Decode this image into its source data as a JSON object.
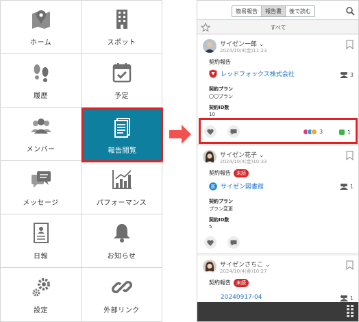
{
  "menu": {
    "items": [
      {
        "label": "ホーム",
        "icon": "map-icon"
      },
      {
        "label": "スポット",
        "icon": "building-icon"
      },
      {
        "label": "履歴",
        "icon": "footprints-icon"
      },
      {
        "label": "予定",
        "icon": "calendar-check-icon"
      },
      {
        "label": "メンバー",
        "icon": "members-icon"
      },
      {
        "label": "報告閲覧",
        "icon": "document-icon"
      },
      {
        "label": "メッセージ",
        "icon": "chat-icon"
      },
      {
        "label": "パフォーマンス",
        "icon": "bar-chart-icon"
      },
      {
        "label": "日報",
        "icon": "daily-report-icon"
      },
      {
        "label": "お知らせ",
        "icon": "bell-icon"
      },
      {
        "label": "設定",
        "icon": "gears-icon"
      },
      {
        "label": "外部リンク",
        "icon": "link-icon"
      }
    ],
    "active_index": 5
  },
  "colors": {
    "accent": "#0e7f9e",
    "highlight": "#e02424",
    "link": "#1e73c8",
    "badge": "#d62828"
  },
  "phone": {
    "tabs": [
      "簡易報告",
      "報告書",
      "後で読む"
    ],
    "active_tab": "報告書",
    "filter_label": "すべて",
    "cards": [
      {
        "user": "サイゼン一郎",
        "date": "2024/10/4(金)11:23",
        "report_type": "契約報告",
        "unread": "",
        "link_text": "レッドフォックス株式会社",
        "count": "3",
        "fields": [
          {
            "label": "契約プラン",
            "value": "〇〇プラン"
          },
          {
            "label": "契約ID数",
            "value": "10"
          }
        ],
        "reactions_count": "3",
        "comments_count": "1"
      },
      {
        "user": "サイゼン花子",
        "date": "2024/10/4(金)10:33",
        "report_type": "契約報告",
        "unread": "未読",
        "link_text": "サイゼン図書館",
        "count": "1",
        "fields": [
          {
            "label": "契約プラン",
            "value": "プラン変更"
          },
          {
            "label": "契約ID数",
            "value": "5"
          }
        ]
      },
      {
        "user": "サイゼンさちこ",
        "date": "2024/10/4(金)10:27",
        "report_type": "契約報告",
        "unread": "未読",
        "link_text": "20240917-04",
        "count": "1"
      }
    ]
  }
}
